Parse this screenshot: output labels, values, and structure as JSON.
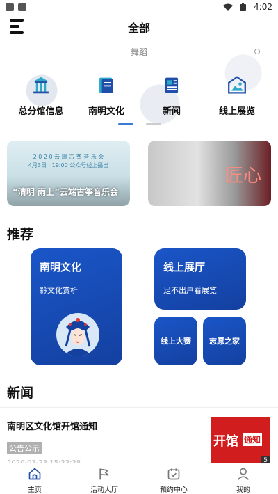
{
  "status_bar": {
    "time": "4:02"
  },
  "header": {
    "title": "全部"
  },
  "search": {
    "placeholder": "舞蹈"
  },
  "categories": [
    {
      "label": "总分馆信息",
      "icon": "building-icon"
    },
    {
      "label": "南明文化",
      "icon": "book-icon"
    },
    {
      "label": "新闻",
      "icon": "newspaper-icon"
    },
    {
      "label": "线上展览",
      "icon": "gallery-icon"
    }
  ],
  "carousel": {
    "active_index": 0,
    "count": 2
  },
  "banners": [
    {
      "small_title": "2 0 2 0 云 端 古 筝 音 乐 会",
      "date_line": "4月3日 · 19:00  公众号线上播出",
      "caption": "“清明 雨上”云端古筝音乐会"
    },
    {
      "art_text": "匠心"
    }
  ],
  "recommend": {
    "title": "推荐",
    "big_card": {
      "title": "南明文化",
      "subtitle": "黔文化赏析"
    },
    "mid_card": {
      "title": "线上展厅",
      "subtitle": "足不出户看展览"
    },
    "small_cards": [
      "线上大赛",
      "志愿之家"
    ]
  },
  "news": {
    "title": "新闻",
    "items": [
      {
        "title": "南明区文化馆开馆通知",
        "tag": "公告公示",
        "date": "2020-03-23 15:33:38",
        "thumb_text": "开馆",
        "thumb_text2": "通知",
        "thumb_badge": "5"
      }
    ]
  },
  "tabbar": [
    {
      "label": "主页",
      "icon": "home-icon",
      "active": true
    },
    {
      "label": "活动大厅",
      "icon": "flag-icon",
      "active": false
    },
    {
      "label": "预约中心",
      "icon": "calendar-check-icon",
      "active": false
    },
    {
      "label": "我的",
      "icon": "user-icon",
      "active": false
    }
  ],
  "colors": {
    "accent": "#1a56c8",
    "news_thumb": "#d11d1d",
    "active_dot": "#3a7bd5"
  }
}
